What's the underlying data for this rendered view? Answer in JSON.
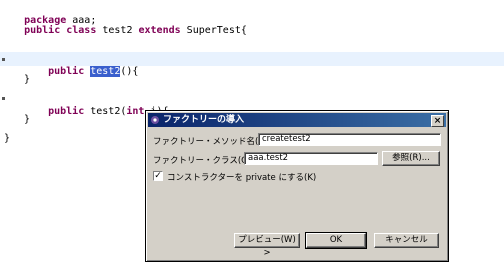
{
  "editor": {
    "line1_kw": "package",
    "line1_rest": " aaa;",
    "line2_kw1": "public class",
    "line2_name": " test2 ",
    "line2_kw2": "extends",
    "line2_rest": " SuperTest{",
    "line3_kw": "public",
    "line3_sel": "test2",
    "line3_rest": "(){",
    "line4": "}",
    "line5_kw": "public",
    "line5_mid": " test2(",
    "line5_kw2": "int",
    "line5_rest": " i){",
    "line6": "}",
    "line7": "}"
  },
  "dialog": {
    "title": "ファクトリーの導入",
    "close": "×",
    "method_label": "ファクトリー・メソッド名(N):",
    "method_value": "createtest2",
    "class_label": "ファクトリー・クラス(C):",
    "class_value": "aaa.test2",
    "browse_label": "参照(R)...",
    "private_label": "コンストラクターを private にする(K)",
    "private_checked": "✓",
    "preview_label": "プレビュー(W) >",
    "ok_label": "OK",
    "cancel_label": "キャンセル"
  }
}
